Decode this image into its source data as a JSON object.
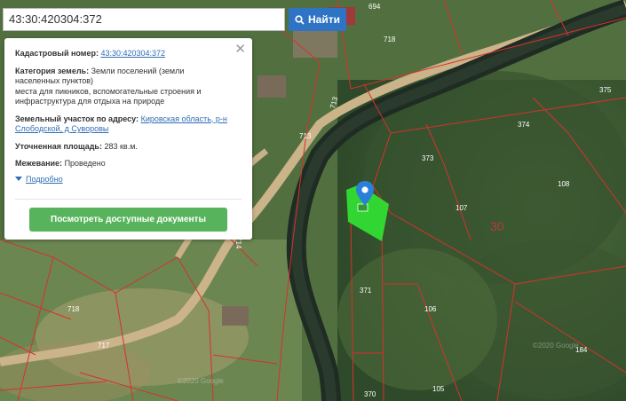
{
  "search": {
    "value": "43:30:420304:372",
    "button_label": "Найти"
  },
  "popup": {
    "cadastral_label": "Кадастровый номер:",
    "cadastral_value": "43:30:420304:372",
    "category_label": "Категория земель:",
    "category_value_1": "Земли поселений (земли",
    "category_value_2": "населенных пунктов)",
    "category_value_3": "места для пикников, вспомогательные строения и",
    "category_value_4": "инфраструктура для отдыха на природе",
    "address_label": "Земельный участок по адресу:",
    "address_link_1": "Кировская область, р-н",
    "address_link_2": "Слободской, д Суворовы",
    "area_label": "Уточненная площадь:",
    "area_value": "283 кв.м.",
    "survey_label": "Межевание:",
    "survey_value": "Проведено",
    "more_label": "Подробно",
    "docs_button": "Посмотреть доступные документы"
  },
  "map": {
    "district_label": "30",
    "parcels": [
      "694",
      "718",
      "375",
      "713",
      "374",
      "713",
      "373",
      "108",
      "107",
      "714",
      "371",
      "106",
      "718",
      "717",
      "184",
      "370",
      "105"
    ],
    "watermarks": [
      "©2020 Google",
      "©2020 Google"
    ]
  },
  "colors": {
    "highlight": "#33dd33",
    "pin": "#2a7fd6",
    "boundary": "#d9302e"
  }
}
